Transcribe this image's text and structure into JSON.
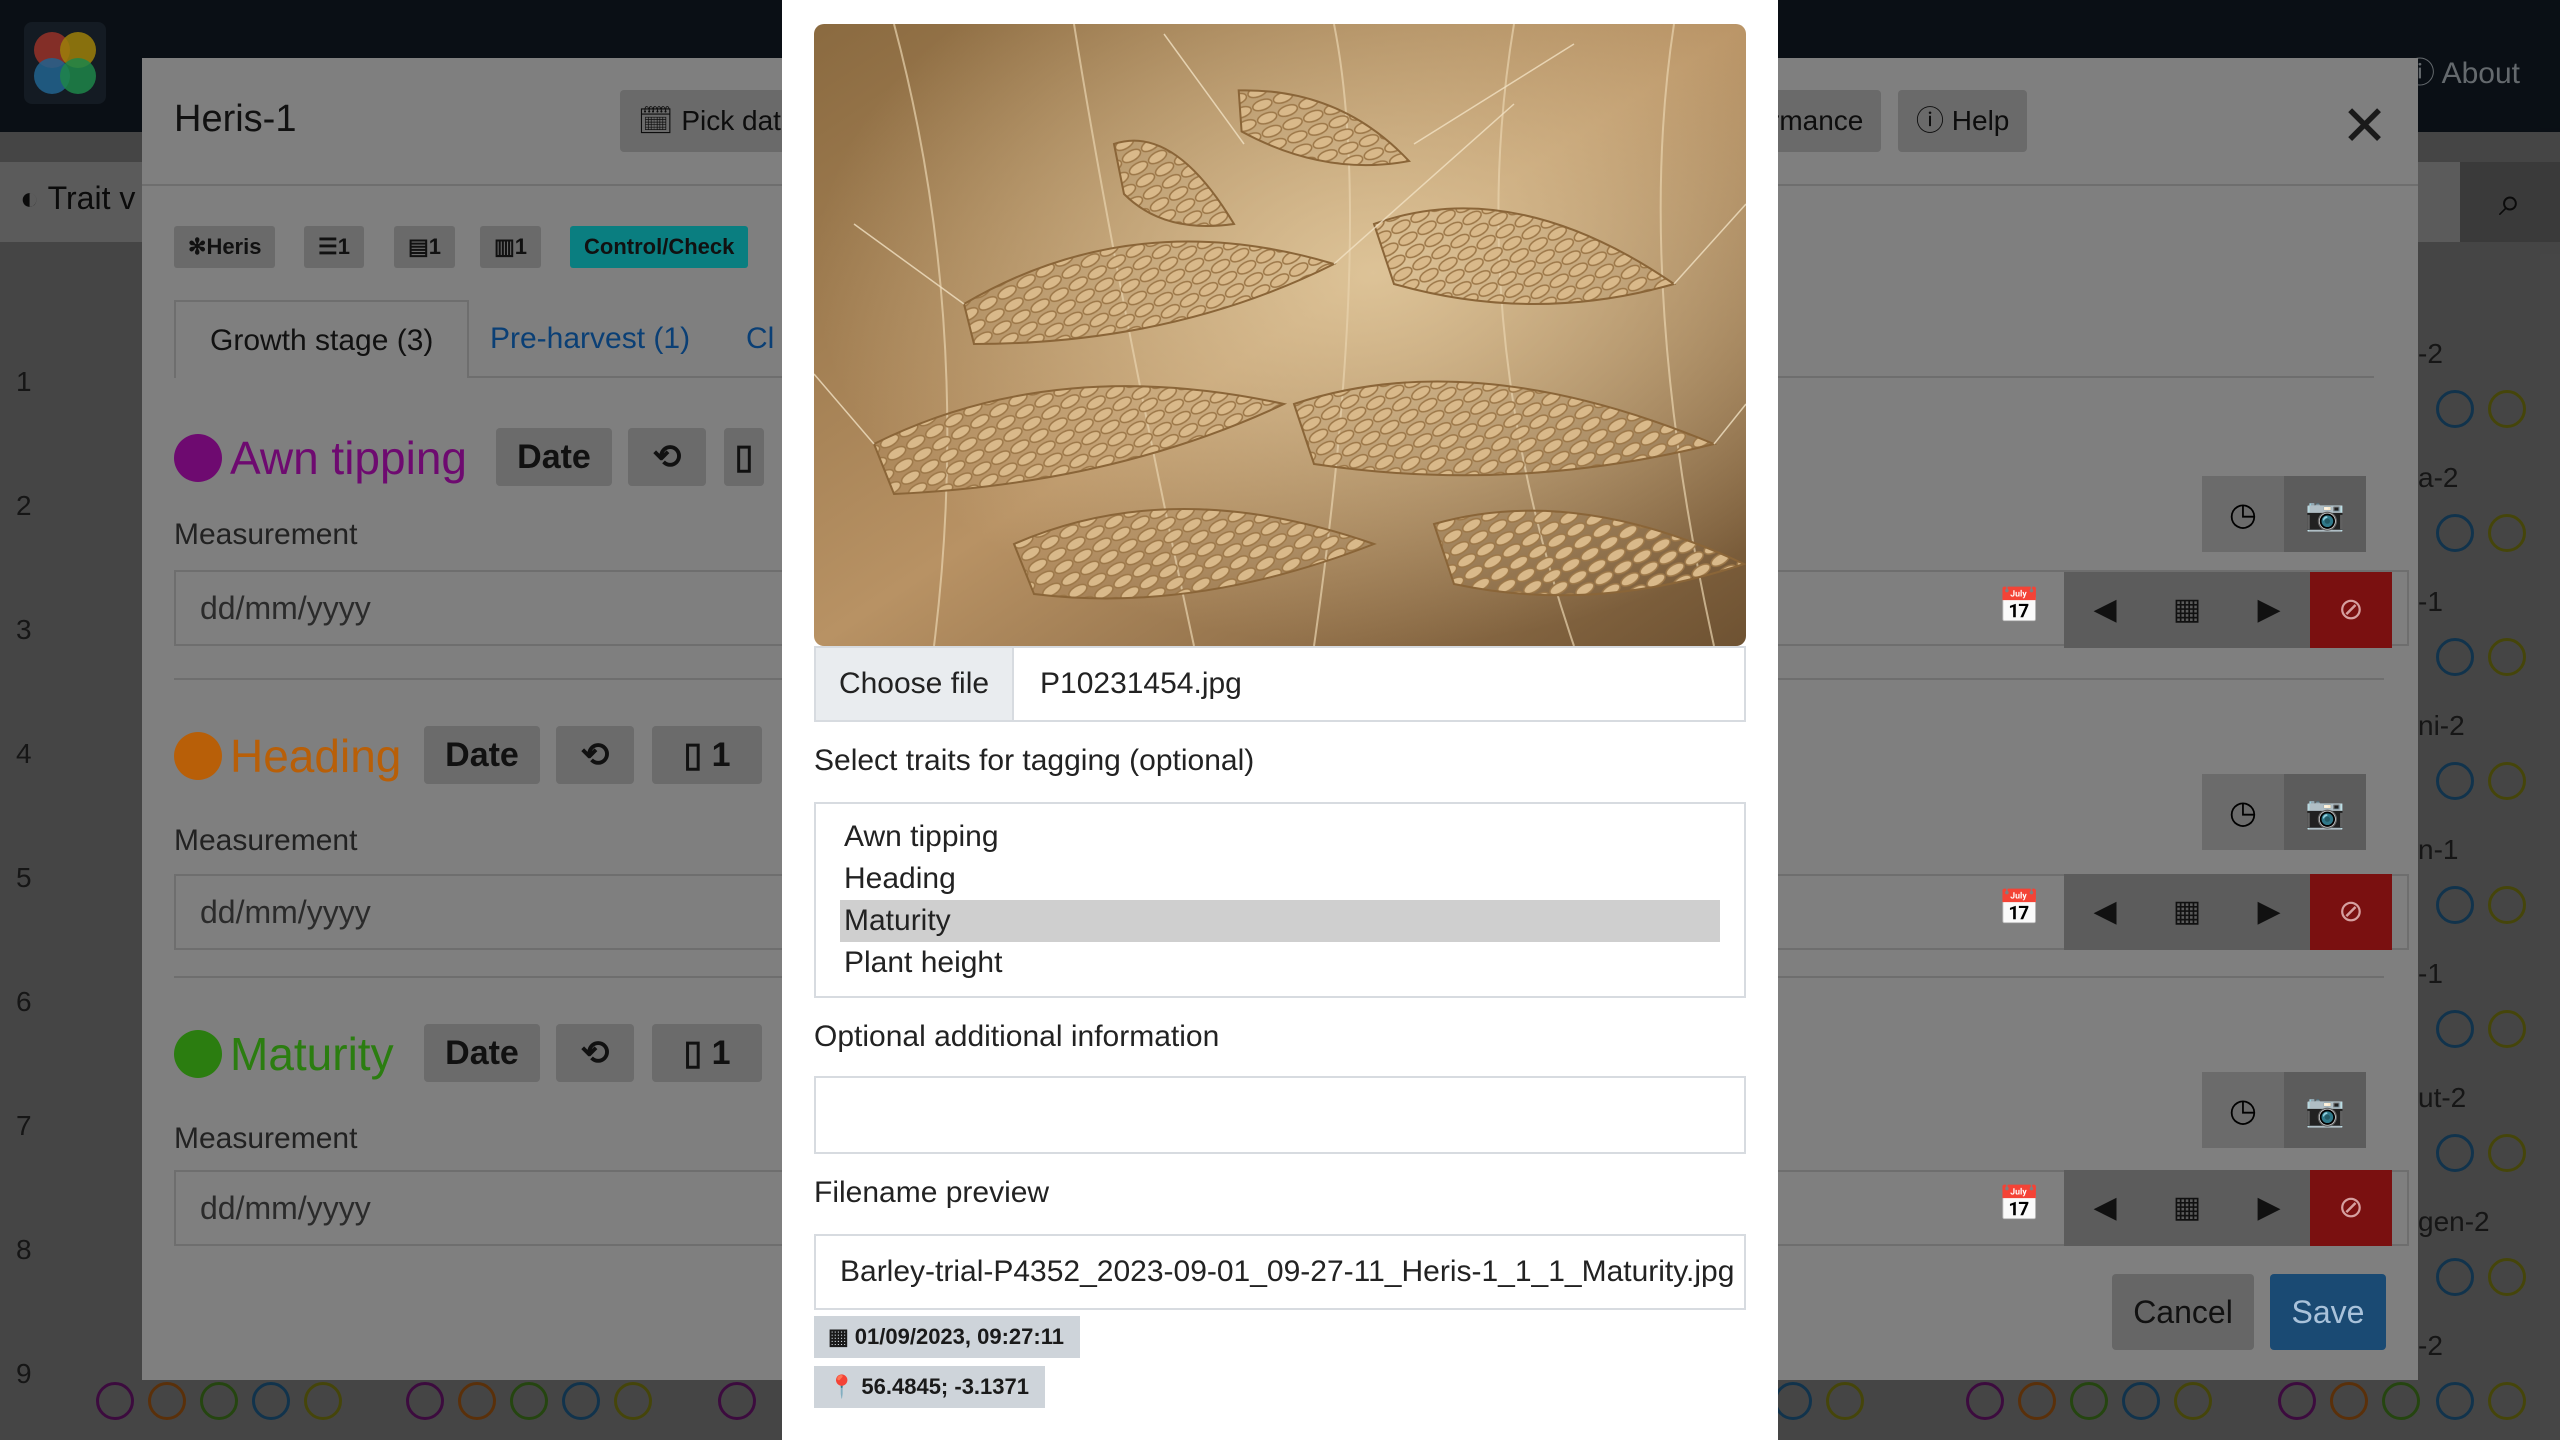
{
  "app": {
    "nav_about": "About",
    "trait_view_label": "Trait v",
    "row_numbers": [
      "1",
      "2",
      "3",
      "4",
      "5",
      "6",
      "7",
      "8",
      "9"
    ],
    "right_cells": [
      "-2",
      "a-2",
      "-1",
      "ni-2",
      "n-1",
      "-1",
      "ut-2",
      "gen-2",
      "-2"
    ]
  },
  "modal": {
    "title": "Heris-1",
    "pick_date_label": "Pick date",
    "performance_label": "rmance",
    "help_label": "Help",
    "badges": [
      {
        "icon": "asterisk-icon",
        "label": "Heris"
      },
      {
        "icon": "list-icon",
        "label": "1"
      },
      {
        "icon": "rows-icon",
        "label": "1"
      },
      {
        "icon": "columns-icon",
        "label": "1"
      },
      {
        "icon": "",
        "label": "Control/Check"
      }
    ],
    "tabs": [
      "Growth stage (3)",
      "Pre-harvest (1)",
      "Cl"
    ],
    "traits": [
      {
        "name": "Awn tipping",
        "color": "#6e0a70",
        "type": "Date",
        "count": "",
        "measurement_label": "Measurement",
        "placeholder": "dd/mm/yyyy"
      },
      {
        "name": "Heading",
        "color": "#b85f08",
        "type": "Date",
        "count": "1",
        "measurement_label": "Measurement",
        "placeholder": "dd/mm/yyyy"
      },
      {
        "name": "Maturity",
        "color": "#2b7d10",
        "type": "Date",
        "count": "1",
        "measurement_label": "Measurement",
        "placeholder": "dd/mm/yyyy"
      }
    ],
    "cancel_label": "Cancel",
    "save_label": "Save"
  },
  "dialog": {
    "choose_file_label": "Choose file",
    "file_name": "P10231454.jpg",
    "tagging_label": "Select traits for tagging (optional)",
    "trait_options": [
      "Awn tipping",
      "Heading",
      "Maturity",
      "Plant height"
    ],
    "selected_option": "Maturity",
    "additional_info_label": "Optional additional information",
    "additional_info_value": "",
    "filename_preview_label": "Filename preview",
    "filename_preview": "Barley-trial-P4352_2023-09-01_09-27-11_Heris-1_1_1_Maturity.jpg",
    "timestamp_badge": "01/09/2023, 09:27:11",
    "location_badge": "56.4845; -3.1371"
  }
}
